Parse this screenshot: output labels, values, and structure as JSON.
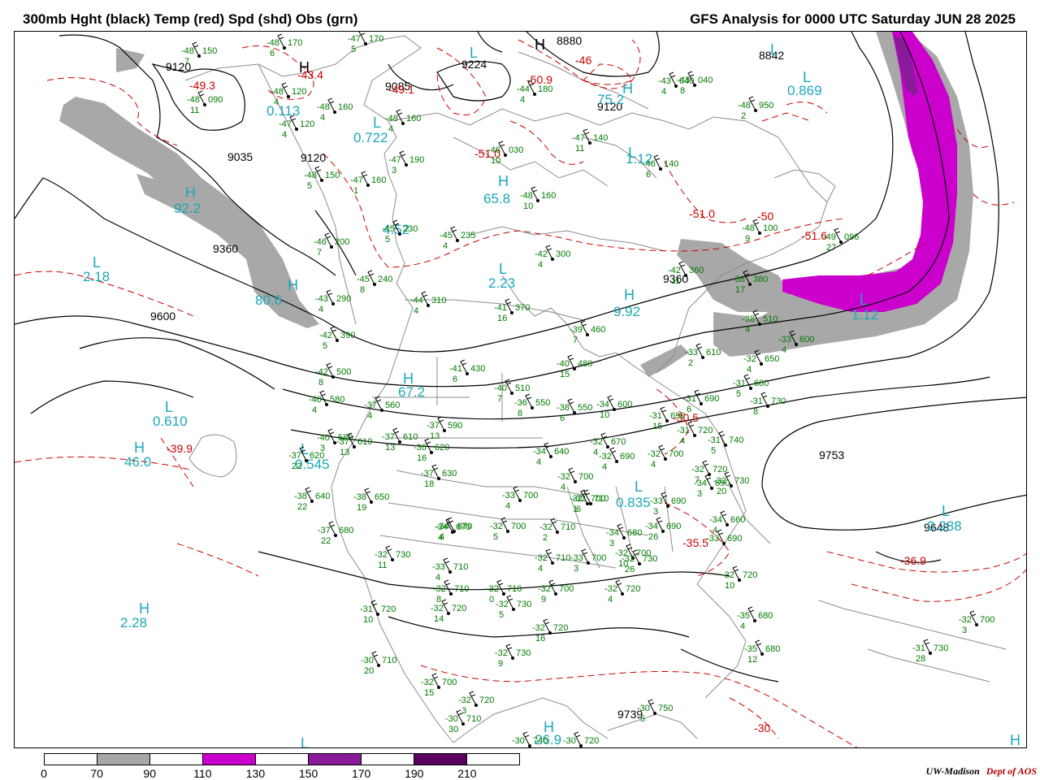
{
  "header": {
    "title_left": "300mb Hght (black) Temp (red) Spd (shd) Obs (grn)",
    "title_right": "GFS Analysis for 0000 UTC Saturday  JUN 28 2025"
  },
  "colors": {
    "height_contour": "#000000",
    "temperature_contour": "#cc0000",
    "observation": "#007a00",
    "coastline": "#8c8c8c",
    "pressure_centers": "#1aa7b8",
    "speed_70_90": "#a8a8a8",
    "speed_110_130": "#cc00cc",
    "speed_150_170": "#8a1a9a",
    "speed_190_210": "#5a0060"
  },
  "height_labels": [
    {
      "text": "9120"
    },
    {
      "text": "9035"
    },
    {
      "text": "9120"
    },
    {
      "text": "9085"
    },
    {
      "text": "9224"
    },
    {
      "text": "8880"
    },
    {
      "text": "8842"
    },
    {
      "text": "9120"
    },
    {
      "text": "9360"
    },
    {
      "text": "9360"
    },
    {
      "text": "9600"
    },
    {
      "text": "9753"
    },
    {
      "text": "9648"
    },
    {
      "text": "9739"
    }
  ],
  "center_letters": [
    {
      "text": "H"
    },
    {
      "text": "L"
    },
    {
      "text": "H"
    },
    {
      "text": "L"
    },
    {
      "text": "H"
    },
    {
      "text": "L"
    },
    {
      "text": "H"
    },
    {
      "text": "L"
    },
    {
      "text": "L"
    },
    {
      "text": "H"
    },
    {
      "text": "L"
    },
    {
      "text": "H"
    },
    {
      "text": "L"
    },
    {
      "text": "H"
    },
    {
      "text": "H"
    },
    {
      "text": "L"
    },
    {
      "text": "H"
    },
    {
      "text": "L"
    },
    {
      "text": "H"
    },
    {
      "text": "L"
    },
    {
      "text": "L"
    },
    {
      "text": "L"
    },
    {
      "text": "H"
    },
    {
      "text": "L"
    },
    {
      "text": "H"
    }
  ],
  "center_values": [
    {
      "text": "0.113"
    },
    {
      "text": "0.722"
    },
    {
      "text": "65.8"
    },
    {
      "text": "92.2"
    },
    {
      "text": "4.52"
    },
    {
      "text": "2.18"
    },
    {
      "text": "80.6"
    },
    {
      "text": "2.23"
    },
    {
      "text": "9.92"
    },
    {
      "text": "67.2"
    },
    {
      "text": "0.610"
    },
    {
      "text": "46.0"
    },
    {
      "text": "0.545"
    },
    {
      "text": "2.28"
    },
    {
      "text": "0.835"
    },
    {
      "text": "0.288"
    },
    {
      "text": "0.869"
    },
    {
      "text": "75.2"
    },
    {
      "text": "1.12"
    },
    {
      "text": "1.12"
    },
    {
      "text": "26.9"
    }
  ],
  "temp_labels": [
    {
      "text": "-49.3"
    },
    {
      "text": "-43.4"
    },
    {
      "text": "-51.0"
    },
    {
      "text": "-50.9"
    },
    {
      "text": "-51.0"
    },
    {
      "text": "-50"
    },
    {
      "text": "-51.6"
    },
    {
      "text": "-39.9"
    },
    {
      "text": "-30.5"
    },
    {
      "text": "-35.5"
    },
    {
      "text": "-36.9"
    },
    {
      "text": "-30"
    },
    {
      "text": "-49.1"
    },
    {
      "text": "-46"
    }
  ],
  "obs": [
    {
      "t": "-48",
      "h": "150",
      "d": "7"
    },
    {
      "t": "-48",
      "h": "170",
      "d": "6"
    },
    {
      "t": "-47",
      "h": "170",
      "d": "5"
    },
    {
      "t": "-48",
      "h": "090",
      "d": "11"
    },
    {
      "t": "-48",
      "h": "120",
      "d": "4"
    },
    {
      "t": "-48",
      "h": "160",
      "d": "4"
    },
    {
      "t": "-47",
      "h": "120",
      "d": "4"
    },
    {
      "t": "-48",
      "h": "160",
      "d": "4"
    },
    {
      "t": "-44",
      "h": "180",
      "d": "4"
    },
    {
      "t": "-43",
      "h": "040",
      "d": "4"
    },
    {
      "t": "-48",
      "h": "950",
      "d": "2"
    },
    {
      "t": "-47",
      "h": "190",
      "d": "3"
    },
    {
      "t": "-47",
      "h": "140",
      "d": "11"
    },
    {
      "t": "-46",
      "h": "140",
      "d": "6"
    },
    {
      "t": "-48",
      "h": "150",
      "d": "5"
    },
    {
      "t": "-47",
      "h": "160",
      "d": "1"
    },
    {
      "t": "-48",
      "h": "160",
      "d": "10"
    },
    {
      "t": "-46",
      "h": "200",
      "d": "7"
    },
    {
      "t": "-45",
      "h": "230",
      "d": "5"
    },
    {
      "t": "-45",
      "h": "235",
      "d": "4"
    },
    {
      "t": "-42",
      "h": "300",
      "d": "4"
    },
    {
      "t": "-48",
      "h": "100",
      "d": "9"
    },
    {
      "t": "-49",
      "h": "096",
      "d": "27"
    },
    {
      "t": "-45",
      "h": "240",
      "d": "8"
    },
    {
      "t": "-44",
      "h": "310",
      "d": "4"
    },
    {
      "t": "-43",
      "h": "290",
      "d": "4"
    },
    {
      "t": "-41",
      "h": "370",
      "d": "16"
    },
    {
      "t": "-42",
      "h": "360",
      "d": "11"
    },
    {
      "t": "-38",
      "h": "380",
      "d": "17"
    },
    {
      "t": "-42",
      "h": "390",
      "d": "5"
    },
    {
      "t": "-39",
      "h": "460",
      "d": "7"
    },
    {
      "t": "-38",
      "h": "510",
      "d": "4"
    },
    {
      "t": "-33",
      "h": "600",
      "d": "4"
    },
    {
      "t": "-42",
      "h": "500",
      "d": "8"
    },
    {
      "t": "-41",
      "h": "430",
      "d": "6"
    },
    {
      "t": "-40",
      "h": "480",
      "d": "15"
    },
    {
      "t": "-33",
      "h": "610",
      "d": "2"
    },
    {
      "t": "-32",
      "h": "650",
      "d": "4"
    },
    {
      "t": "-40",
      "h": "510",
      "d": "7"
    },
    {
      "t": "-31",
      "h": "680",
      "d": "5"
    },
    {
      "t": "-40",
      "h": "580",
      "d": "4"
    },
    {
      "t": "-37",
      "h": "560",
      "d": "4"
    },
    {
      "t": "-36",
      "h": "550",
      "d": "8"
    },
    {
      "t": "-38",
      "h": "550",
      "d": "6"
    },
    {
      "t": "-34",
      "h": "600",
      "d": "10"
    },
    {
      "t": "-31",
      "h": "690",
      "d": "6"
    },
    {
      "t": "-31",
      "h": "730",
      "d": "8"
    },
    {
      "t": "-40",
      "h": "580",
      "d": "3"
    },
    {
      "t": "-37",
      "h": "590",
      "d": "13"
    },
    {
      "t": "-31",
      "h": "690",
      "d": "15"
    },
    {
      "t": "-31",
      "h": "720",
      "d": "4"
    },
    {
      "t": "-37",
      "h": "610",
      "d": "13"
    },
    {
      "t": "-37",
      "h": "610",
      "d": "13"
    },
    {
      "t": "-36",
      "h": "620",
      "d": "16"
    },
    {
      "t": "-32",
      "h": "670",
      "d": "4"
    },
    {
      "t": "-31",
      "h": "740",
      "d": "5"
    },
    {
      "t": "-37",
      "h": "620",
      "d": "22"
    },
    {
      "t": "-34",
      "h": "640",
      "d": "4"
    },
    {
      "t": "-32",
      "h": "690",
      "d": "4"
    },
    {
      "t": "-32",
      "h": "700",
      "d": "4"
    },
    {
      "t": "-32",
      "h": "720",
      "d": "7"
    },
    {
      "t": "-37",
      "h": "630",
      "d": "18"
    },
    {
      "t": "-32",
      "h": "700",
      "d": "4"
    },
    {
      "t": "-32",
      "h": "710",
      "d": "6"
    },
    {
      "t": "-32",
      "h": "730",
      "d": "20"
    },
    {
      "t": "-38",
      "h": "640",
      "d": "22"
    },
    {
      "t": "-38",
      "h": "650",
      "d": "19"
    },
    {
      "t": "-33",
      "h": "700",
      "d": "4"
    },
    {
      "t": "-32",
      "h": "700",
      "d": "1"
    },
    {
      "t": "-33",
      "h": "690",
      "d": "3"
    },
    {
      "t": "-34",
      "h": "690",
      "d": "3"
    },
    {
      "t": "-34",
      "h": "660",
      "d": "4"
    },
    {
      "t": "-37",
      "h": "680",
      "d": "22"
    },
    {
      "t": "-34",
      "h": "670",
      "d": "4"
    },
    {
      "t": "-32",
      "h": "700",
      "d": "5"
    },
    {
      "t": "-32",
      "h": "710",
      "d": "2"
    },
    {
      "t": "-34",
      "h": "670",
      "d": "4"
    },
    {
      "t": "-34",
      "h": "680",
      "d": "3"
    },
    {
      "t": "-34",
      "h": "690",
      "d": "26"
    },
    {
      "t": "-32",
      "h": "730",
      "d": "11"
    },
    {
      "t": "-33",
      "h": "710",
      "d": "4"
    },
    {
      "t": "-32",
      "h": "710",
      "d": "4"
    },
    {
      "t": "-33",
      "h": "700",
      "d": "3"
    },
    {
      "t": "-32",
      "h": "700",
      "d": "10"
    },
    {
      "t": "-32",
      "h": "720",
      "d": "10"
    },
    {
      "t": "-32",
      "h": "710",
      "d": "8"
    },
    {
      "t": "-32",
      "h": "710",
      "d": "0"
    },
    {
      "t": "-32",
      "h": "700",
      "d": "9"
    },
    {
      "t": "-32",
      "h": "720",
      "d": "4"
    },
    {
      "t": "-32",
      "h": "730",
      "d": "26"
    },
    {
      "t": "-31",
      "h": "720",
      "d": "10"
    },
    {
      "t": "-32",
      "h": "720",
      "d": "14"
    },
    {
      "t": "-32",
      "h": "730",
      "d": "5"
    },
    {
      "t": "-32",
      "h": "720",
      "d": "16"
    },
    {
      "t": "-35",
      "h": "680",
      "d": "4"
    },
    {
      "t": "-32",
      "h": "700",
      "d": "3"
    },
    {
      "t": "-32",
      "h": "730",
      "d": "9"
    },
    {
      "t": "-35",
      "h": "680",
      "d": "12"
    },
    {
      "t": "-31",
      "h": "730",
      "d": "28"
    },
    {
      "t": "-30",
      "h": "710",
      "d": "20"
    },
    {
      "t": "-32",
      "h": "700",
      "d": "15"
    },
    {
      "t": "-32",
      "h": "720",
      "d": "3"
    },
    {
      "t": "-30",
      "h": "710",
      "d": "30"
    },
    {
      "t": "-30",
      "h": "740",
      "d": ""
    },
    {
      "t": "-30",
      "h": "720",
      "d": ""
    },
    {
      "t": "-30",
      "h": "750",
      "d": "5"
    },
    {
      "t": "-33",
      "h": "690",
      "d": ""
    },
    {
      "t": "-43",
      "h": "040",
      "d": "8"
    },
    {
      "t": "-46",
      "h": "030",
      "d": "10"
    }
  ],
  "legend": {
    "ticks": [
      "0",
      "70",
      "90",
      "110",
      "130",
      "150",
      "170",
      "190",
      "210"
    ],
    "seg_colors": [
      "#ffffff",
      "#a8a8a8",
      "#ffffff",
      "#cc00cc",
      "#ffffff",
      "#8a1a9a",
      "#ffffff",
      "#5a0060",
      "#ffffff"
    ]
  },
  "credit": {
    "org": "UW-Madison",
    "dept": "Dept of AOS"
  }
}
